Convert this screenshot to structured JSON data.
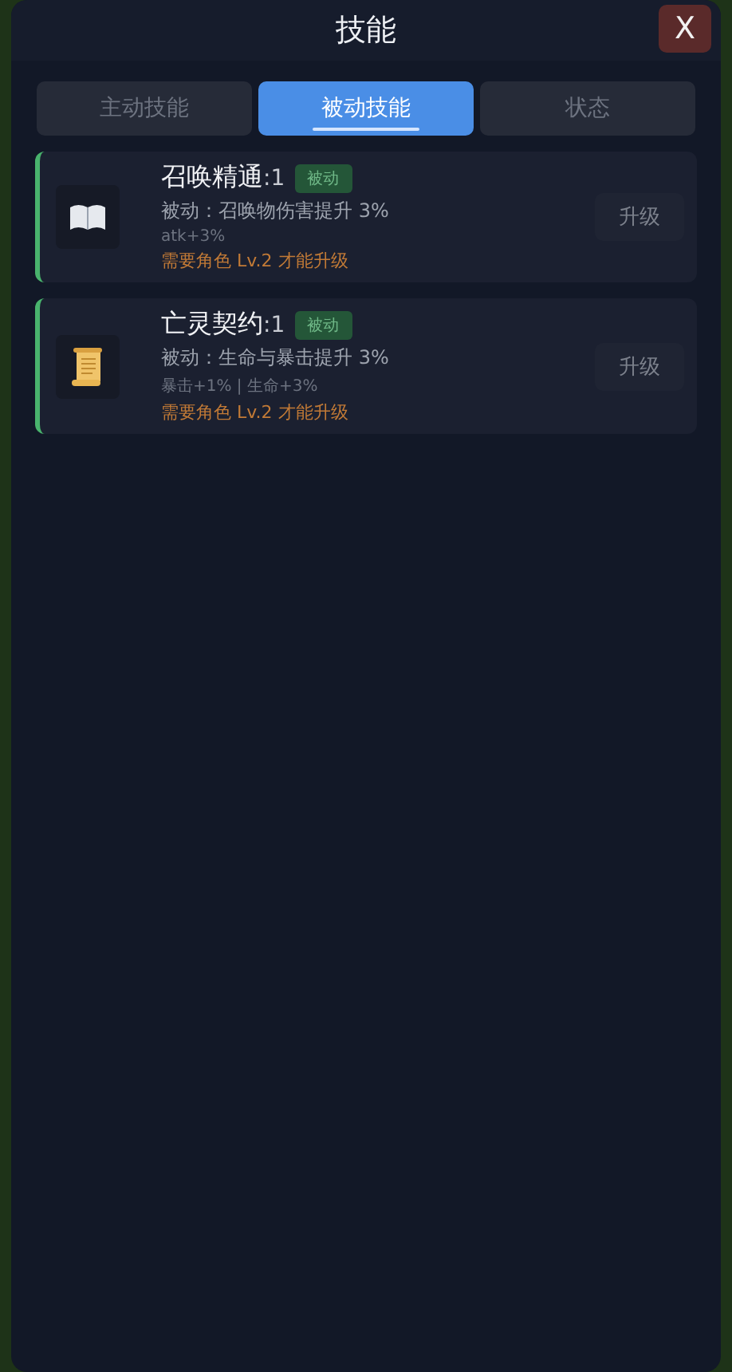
{
  "title": "技能",
  "close": "X",
  "tabs": [
    {
      "label": "主动技能",
      "selected": false
    },
    {
      "label": "被动技能",
      "selected": true
    },
    {
      "label": "状态",
      "selected": false
    }
  ],
  "skills": [
    {
      "kind": "book",
      "name": "召唤精通",
      "level": ":1",
      "badge": "被动",
      "description": "被动：召唤物伤害提升 3%",
      "effect": "atk+3%",
      "requirement": "需要角色 Lv.2 才能升级",
      "button": "升级",
      "disabled": true
    },
    {
      "kind": "scroll",
      "name": "亡灵契约",
      "level": ":1",
      "badge": "被动",
      "description": "被动：生命与暴击提升 3%",
      "effect": "暴击+1% | 生命+3%",
      "requirement": "需要角色 Lv.2 才能升级",
      "button": "升级",
      "disabled": true
    }
  ]
}
